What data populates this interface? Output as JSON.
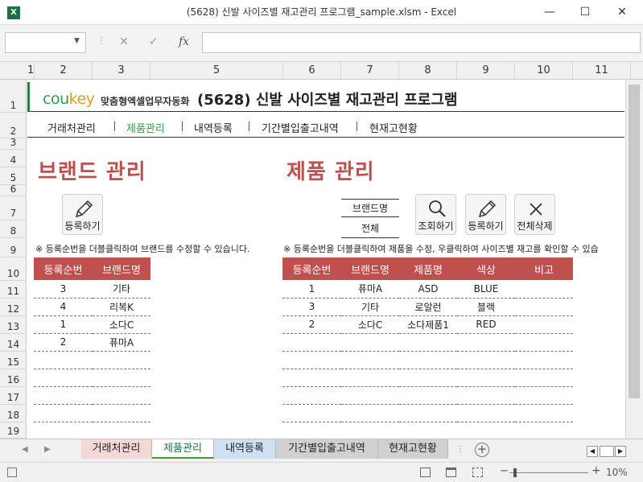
{
  "window": {
    "app_icon": "X",
    "title": "(5628) 신발 사이즈별 재고관리 프로그램_sample.xlsm - Excel",
    "minimize": "—",
    "maximize": "☐",
    "close": "✕"
  },
  "formula_bar": {
    "name_box_value": "",
    "cancel": "✕",
    "enter": "✓",
    "fx": "fx",
    "formula_value": ""
  },
  "columns": [
    "1",
    "2",
    "3",
    "5",
    "6",
    "7",
    "8",
    "9",
    "10",
    "11"
  ],
  "rows": [
    "1",
    "2",
    "3",
    "4",
    "5",
    "6",
    "7",
    "8",
    "9",
    "10",
    "11",
    "12",
    "13",
    "14",
    "15",
    "16",
    "17",
    "18",
    "19"
  ],
  "header": {
    "logo_co": "cou",
    "logo_key": "key",
    "logo_sub": "맞춤형엑셀업무자동화",
    "title": "(5628) 신발 사이즈별 재고관리 프로그램"
  },
  "menu": [
    "거래처관리",
    "제품관리",
    "내역등록",
    "기간별입출고내역",
    "현재고현황"
  ],
  "brand_section": {
    "title": "브랜드 관리",
    "register_button": "등록하기",
    "note": "※ 등록순번을 더블클릭하여 브랜드를 수정할 수 있습니다.",
    "columns": [
      "등록순번",
      "브랜드명"
    ],
    "rows": [
      [
        "3",
        "기타"
      ],
      [
        "4",
        "리복K"
      ],
      [
        "1",
        "소다C"
      ],
      [
        "2",
        "퓨마A"
      ]
    ]
  },
  "product_section": {
    "title": "제품 관리",
    "filter_label": "브랜드명",
    "filter_value": "전체",
    "search_button": "조회하기",
    "register_button": "등록하기",
    "delete_all_button": "전체삭제",
    "note": "※ 등록순번을 더블클릭하여 제품을 수정, 우클릭하여 사이즈별 재고를 확인할 수 있습",
    "columns": [
      "등록순번",
      "브랜드명",
      "제품명",
      "색상",
      "비고"
    ],
    "rows": [
      [
        "1",
        "퓨마A",
        "ASD",
        "BLUE",
        ""
      ],
      [
        "3",
        "기타",
        "로알런",
        "블랙",
        ""
      ],
      [
        "2",
        "소다C",
        "소다제품1",
        "RED",
        ""
      ]
    ]
  },
  "sheet_tabs": [
    "거래처관리",
    "제품관리",
    "내역등록",
    "기간별입출고내역",
    "현재고현황"
  ],
  "active_tab": "제품관리",
  "tab_colors": [
    "#f4d7d7",
    "#ffffff",
    "#cfe0f3",
    "#d0d0d0",
    "#d0d0d0"
  ],
  "status_bar": {
    "zoom": "10%",
    "minus": "−",
    "plus": "+"
  }
}
